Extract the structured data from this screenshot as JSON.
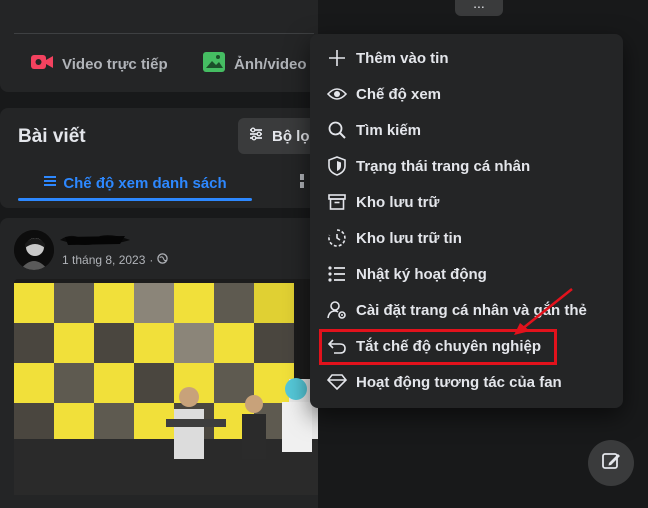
{
  "header": {
    "more_label": "..."
  },
  "create_post": {
    "live_video_label": "Video trực tiếp",
    "photo_video_label": "Ảnh/video",
    "live_video_color": "#f3425f",
    "photo_video_color": "#45bd62"
  },
  "posts": {
    "title": "Bài viết",
    "filter_label": "Bộ lọ",
    "list_view_label": "Chế độ xem danh sách",
    "accent": "#2d88ff"
  },
  "post": {
    "date": "1 tháng 8, 2023",
    "separator": "·",
    "privacy_icon": "globe-icon"
  },
  "menu": {
    "items": [
      {
        "label": "Thêm vào tin",
        "icon": "plus-icon"
      },
      {
        "label": "Chế độ xem",
        "icon": "eye-icon"
      },
      {
        "label": "Tìm kiếm",
        "icon": "search-icon"
      },
      {
        "label": "Trạng thái trang cá nhân",
        "icon": "shield-icon"
      },
      {
        "label": "Kho lưu trữ",
        "icon": "archive-icon"
      },
      {
        "label": "Kho lưu trữ tin",
        "icon": "story-archive-icon"
      },
      {
        "label": "Nhật ký hoạt động",
        "icon": "list-icon"
      },
      {
        "label": "Cài đặt trang cá nhân và gắn thẻ",
        "icon": "profile-settings-icon"
      },
      {
        "label": "Tắt chế độ chuyên nghiệp",
        "icon": "undo-icon"
      },
      {
        "label": "Hoạt động tương tác của fan",
        "icon": "diamond-icon"
      }
    ],
    "highlight_color": "#e2121c"
  },
  "fab": {
    "icon": "edit-icon"
  }
}
